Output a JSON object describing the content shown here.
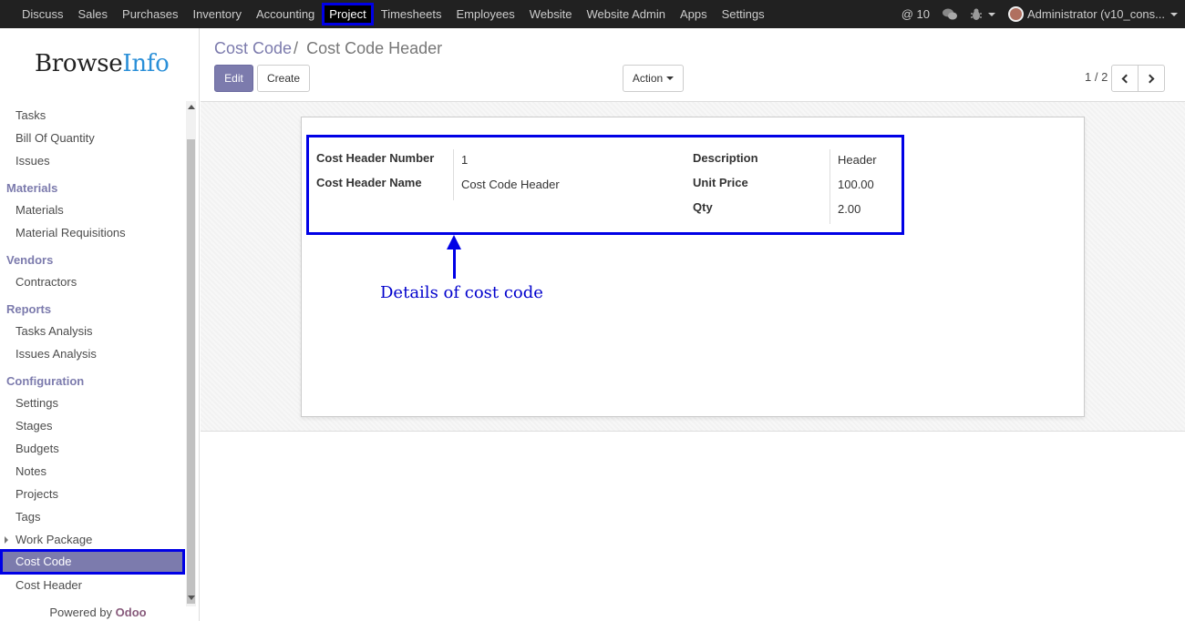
{
  "topbar": {
    "menu": [
      "Discuss",
      "Sales",
      "Purchases",
      "Inventory",
      "Accounting",
      "Project",
      "Timesheets",
      "Employees",
      "Website",
      "Website Admin",
      "Apps",
      "Settings"
    ],
    "active_menu": "Project",
    "notifications": "@ 10",
    "user": "Administrator (v10_cons..."
  },
  "sidebar": {
    "logo_browse": "Browse",
    "logo_info": "Info",
    "items": {
      "tasks": "Tasks",
      "bill_of_quantity": "Bill Of Quantity",
      "issues": "Issues",
      "materials_section": "Materials",
      "materials": "Materials",
      "material_requisitions": "Material Requisitions",
      "vendors_section": "Vendors",
      "contractors": "Contractors",
      "reports_section": "Reports",
      "tasks_analysis": "Tasks Analysis",
      "issues_analysis": "Issues Analysis",
      "configuration_section": "Configuration",
      "settings": "Settings",
      "stages": "Stages",
      "budgets": "Budgets",
      "notes": "Notes",
      "projects": "Projects",
      "tags": "Tags",
      "work_package": "Work Package",
      "cost_code": "Cost Code",
      "cost_header": "Cost Header"
    },
    "powered_by": "Powered by",
    "powered_brand": "Odoo"
  },
  "control": {
    "breadcrumb_parent": "Cost Code",
    "breadcrumb_sep": "/",
    "breadcrumb_current": "Cost Code Header",
    "edit_label": "Edit",
    "create_label": "Create",
    "action_label": "Action",
    "pager": "1 / 2"
  },
  "form": {
    "cost_header_number_label": "Cost Header Number",
    "cost_header_number": "1",
    "cost_header_name_label": "Cost Header Name",
    "cost_header_name": "Cost Code Header",
    "description_label": "Description",
    "description": "Header",
    "unit_price_label": "Unit Price",
    "unit_price": "100.00",
    "qty_label": "Qty",
    "qty": "2.00"
  },
  "annotation": "Details of cost code",
  "colors": {
    "brand": "#7c7bad",
    "highlight": "#0000e6",
    "topbar": "#212121"
  }
}
